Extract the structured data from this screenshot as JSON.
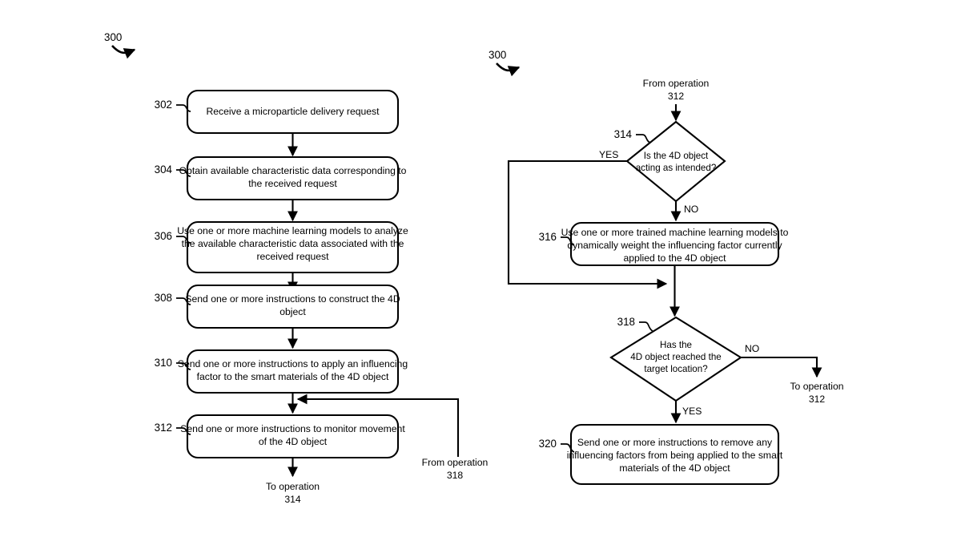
{
  "figure": {
    "left_panel_number": "300",
    "right_panel_number": "300"
  },
  "left_panel": {
    "steps": [
      {
        "ref": "302",
        "lines": [
          "Receive a microparticle delivery request"
        ]
      },
      {
        "ref": "304",
        "lines": [
          "Obtain available characteristic data corresponding to",
          "the received request"
        ]
      },
      {
        "ref": "306",
        "lines": [
          "Use one or more machine learning models to analyze",
          "the available characteristic data associated with the",
          "received request"
        ]
      },
      {
        "ref": "308",
        "lines": [
          "Send one or more instructions to construct the 4D",
          "object"
        ]
      },
      {
        "ref": "310",
        "lines": [
          "Send one or more instructions to apply an influencing",
          "factor to the smart materials of the 4D object"
        ]
      },
      {
        "ref": "312",
        "lines": [
          "Send one or more instructions to monitor movement",
          "of the 4D object"
        ]
      }
    ],
    "exit_note": {
      "line1": "To operation",
      "line2": "314"
    },
    "return_note": {
      "line1": "From operation",
      "line2": "318"
    }
  },
  "right_panel": {
    "entry_note": {
      "line1": "From operation",
      "line2": "312"
    },
    "decision_314": {
      "ref": "314",
      "lines": [
        "Is the 4D object",
        "acting as intended?"
      ],
      "yes_label": "YES",
      "no_label": "NO"
    },
    "step_316": {
      "ref": "316",
      "lines": [
        "Use one or more trained machine learning models to",
        "dynamically weight the influencing factor currently",
        "applied to the 4D object"
      ]
    },
    "decision_318": {
      "ref": "318",
      "lines": [
        "Has the",
        "4D object reached the",
        "target location?"
      ],
      "yes_label": "YES",
      "no_label": "NO"
    },
    "no_exit_note": {
      "line1": "To operation",
      "line2": "312"
    },
    "step_320": {
      "ref": "320",
      "lines": [
        "Send one or more instructions to remove any",
        "influencing factors from being applied to the smart",
        "materials of the 4D object"
      ]
    }
  }
}
